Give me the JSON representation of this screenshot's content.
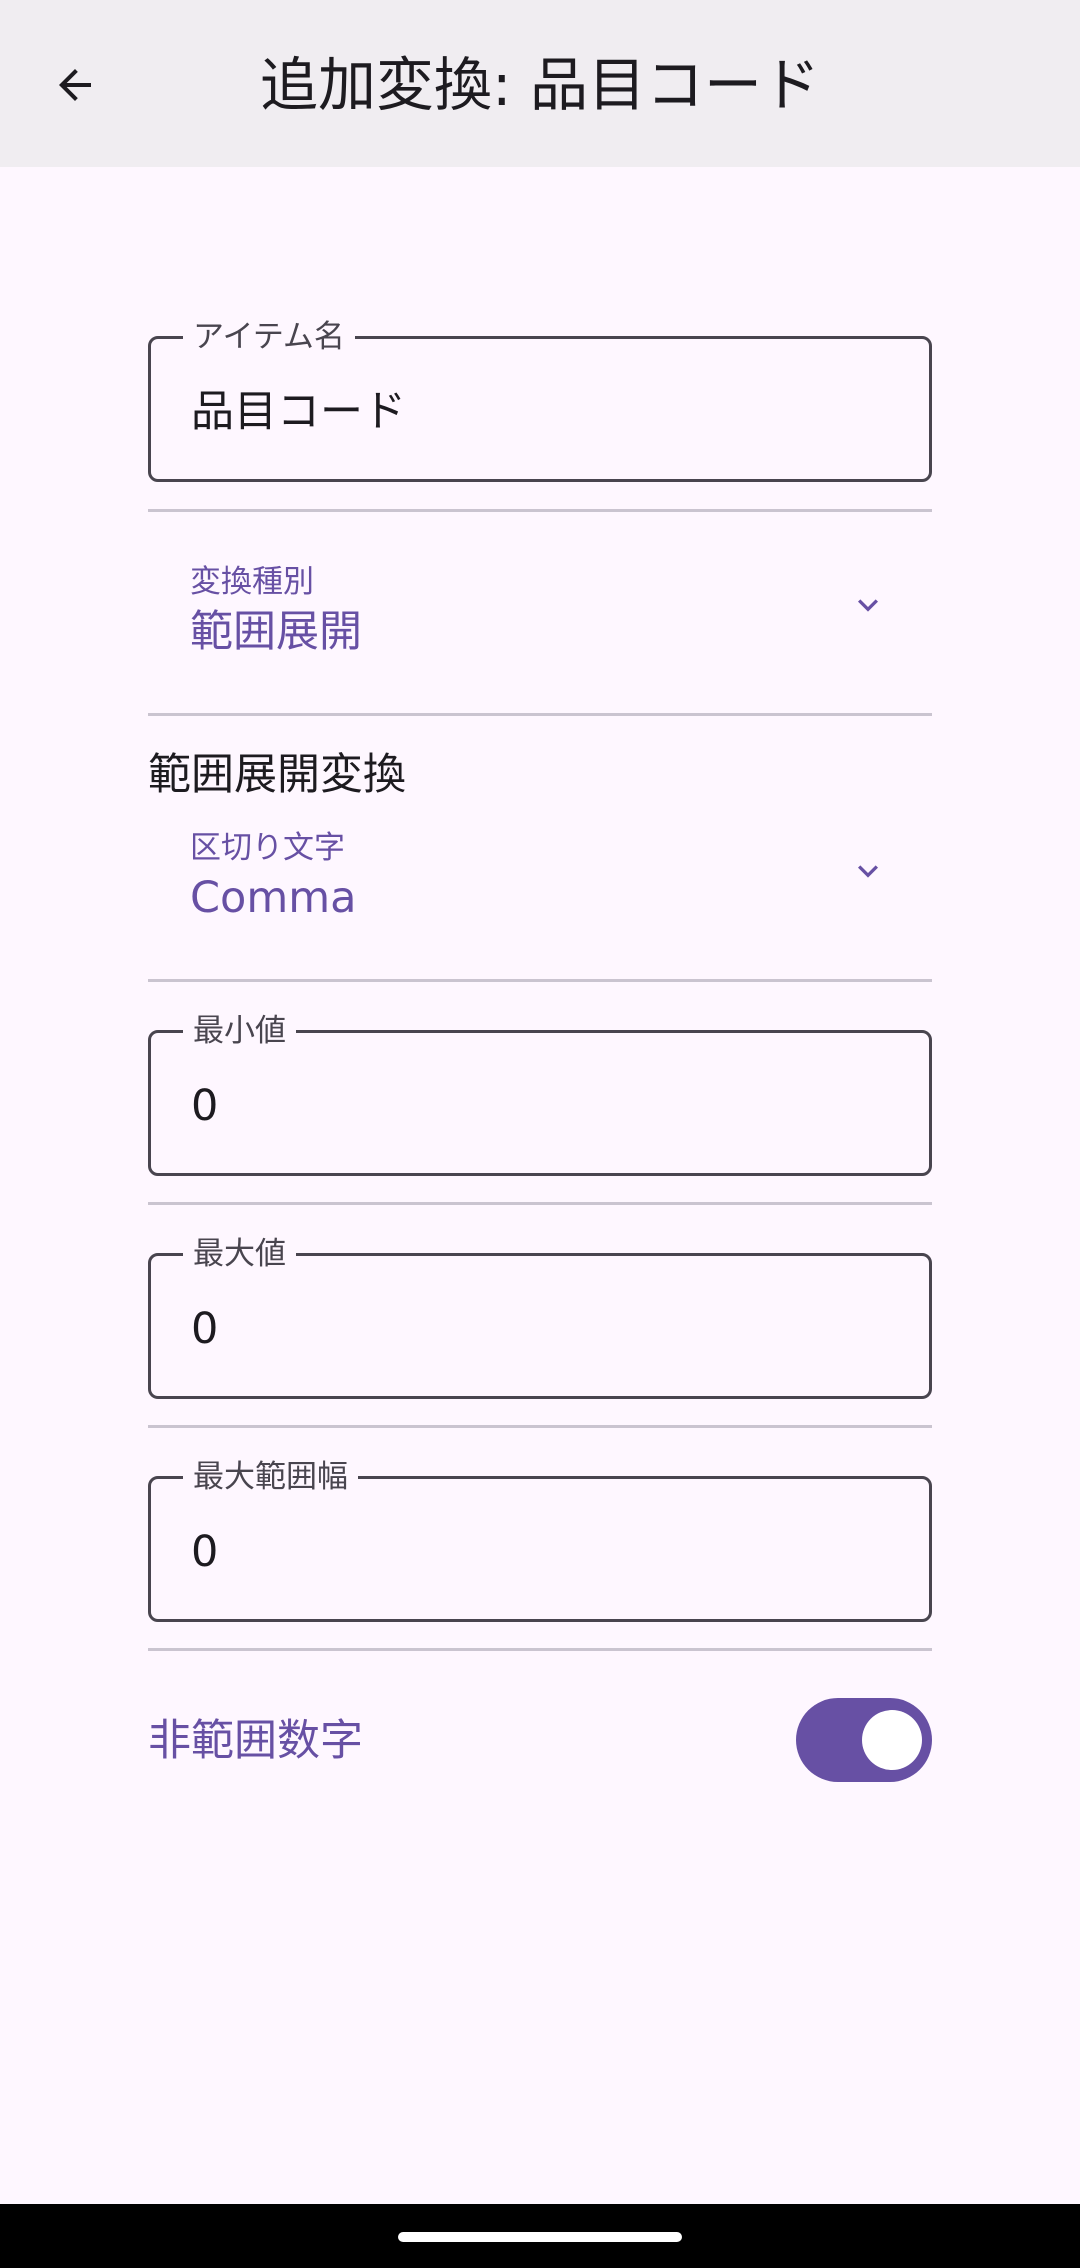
{
  "appbar": {
    "title": "追加変換: 品目コード",
    "back_icon": "arrow-back-icon"
  },
  "item_name": {
    "label": "アイテム名",
    "value": "品目コード"
  },
  "conversion_type": {
    "label": "変換種別",
    "value": "範囲展開",
    "icon": "chevron-down-icon"
  },
  "range_section": {
    "title": "範囲展開変換"
  },
  "delimiter": {
    "label": "区切り文字",
    "value": "Comma",
    "icon": "chevron-down-icon"
  },
  "min_value": {
    "label": "最小値",
    "value": "0"
  },
  "max_value": {
    "label": "最大値",
    "value": "0"
  },
  "max_range_width": {
    "label": "最大範囲幅",
    "value": "0"
  },
  "non_range_number": {
    "label": "非範囲数字",
    "enabled": true
  },
  "colors": {
    "primary": "#6750A4",
    "background": "#FEF7FF",
    "appbar": "#F0EDF1",
    "outline": "#49454F",
    "divider": "#CAC4D0"
  }
}
